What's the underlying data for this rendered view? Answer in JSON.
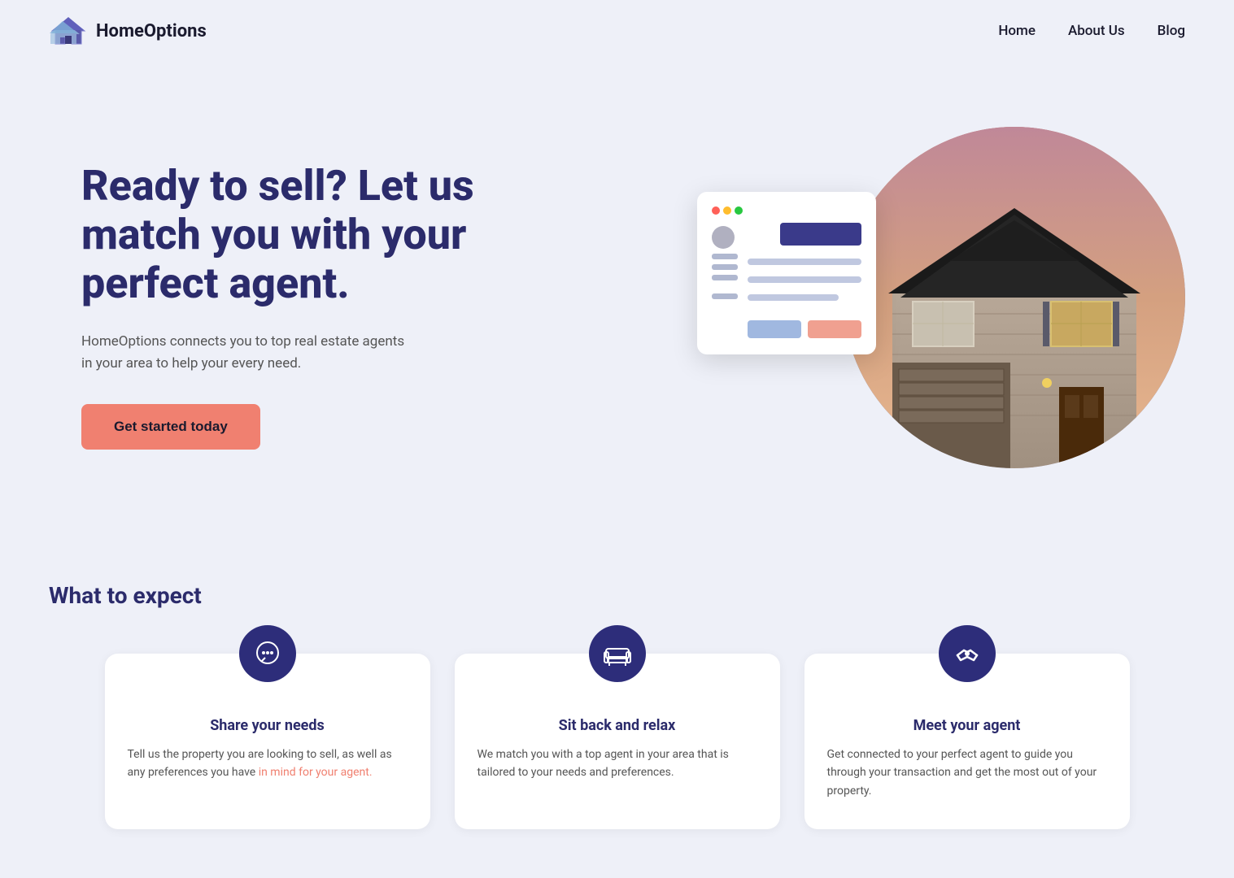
{
  "nav": {
    "logo_text": "HomeOptions",
    "links": [
      {
        "id": "home",
        "label": "Home"
      },
      {
        "id": "about",
        "label": "About Us"
      },
      {
        "id": "blog",
        "label": "Blog"
      }
    ]
  },
  "hero": {
    "heading": "Ready to sell? Let us match you with your perfect agent.",
    "subtext": "HomeOptions connects you to top real estate agents in your area to help your every need.",
    "cta_label": "Get started today"
  },
  "section": {
    "title": "What to expect",
    "cards": [
      {
        "id": "share",
        "title": "Share your needs",
        "icon": "💬",
        "text": "Tell us the property you are looking to sell, as well as any preferences you have in mind for your agent.",
        "link_text": "in mind for your agent.",
        "link_href": "#"
      },
      {
        "id": "relax",
        "title": "Sit back and relax",
        "icon": "🛋",
        "text": "We match you with a top agent in your area that is tailored to your needs and preferences."
      },
      {
        "id": "meet",
        "title": "Meet your agent",
        "icon": "🤝",
        "text": "Get connected to your perfect agent to guide you through your transaction and get the most out of your property."
      }
    ]
  },
  "colors": {
    "brand_dark": "#2b2b6b",
    "brand_circle": "#2d2d7a",
    "cta_bg": "#f08070",
    "bg": "#eef0f8"
  }
}
